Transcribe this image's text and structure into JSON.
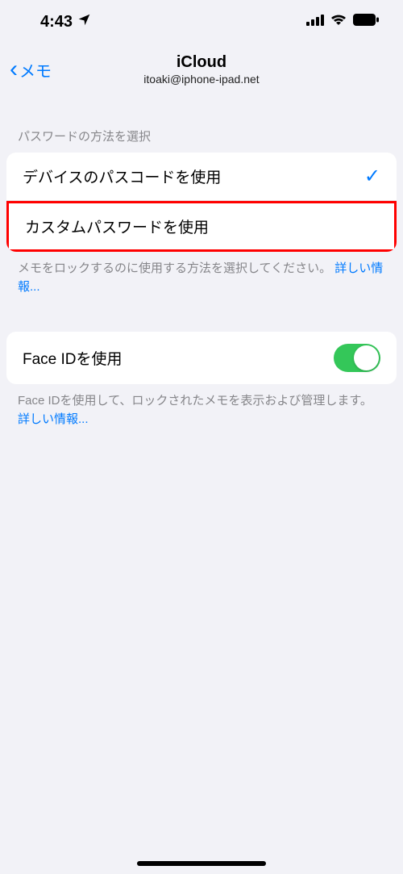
{
  "statusBar": {
    "time": "4:43"
  },
  "nav": {
    "backLabel": "メモ",
    "title": "iCloud",
    "subtitle": "itoaki@iphone-ipad.net"
  },
  "section1": {
    "header": "パスワードの方法を選択",
    "items": [
      {
        "label": "デバイスのパスコードを使用",
        "checked": true
      },
      {
        "label": "カスタムパスワードを使用",
        "checked": false
      }
    ],
    "footerText": "メモをロックするのに使用する方法を選択してください。 ",
    "footerLink": "詳しい情報..."
  },
  "section2": {
    "item": {
      "label": "Face IDを使用",
      "toggled": true
    },
    "footerText": "Face IDを使用して、ロックされたメモを表示および管理します。 ",
    "footerLink": "詳しい情報..."
  }
}
